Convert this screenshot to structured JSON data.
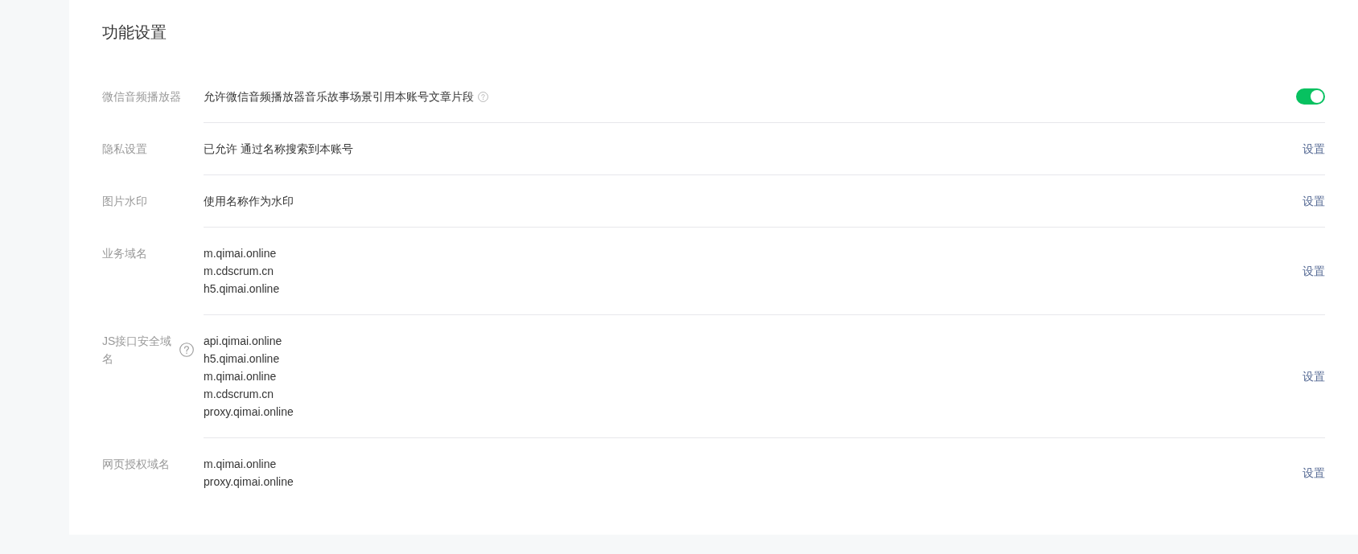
{
  "section": {
    "title": "功能设置"
  },
  "settings": [
    {
      "kind": "toggle",
      "label": "微信音频播放器",
      "label_hint": false,
      "values": [
        "允许微信音频播放器音乐故事场景引用本账号文章片段"
      ],
      "value_hint": true,
      "on": true
    },
    {
      "kind": "link",
      "label": "隐私设置",
      "label_hint": false,
      "values": [
        "已允许 通过名称搜索到本账号"
      ],
      "value_hint": false,
      "action": "设置"
    },
    {
      "kind": "link",
      "label": "图片水印",
      "label_hint": false,
      "values": [
        "使用名称作为水印"
      ],
      "value_hint": false,
      "action": "设置"
    },
    {
      "kind": "link",
      "label": "业务域名",
      "label_hint": false,
      "values": [
        "m.qimai.online",
        "m.cdscrum.cn",
        "h5.qimai.online"
      ],
      "value_hint": false,
      "action": "设置"
    },
    {
      "kind": "link",
      "label": "JS接口安全域名",
      "label_hint": true,
      "values": [
        "api.qimai.online",
        "h5.qimai.online",
        "m.qimai.online",
        "m.cdscrum.cn",
        "proxy.qimai.online"
      ],
      "value_hint": false,
      "action": "设置"
    },
    {
      "kind": "link",
      "label": "网页授权域名",
      "label_hint": false,
      "values": [
        "m.qimai.online",
        "proxy.qimai.online"
      ],
      "value_hint": false,
      "action": "设置"
    }
  ]
}
